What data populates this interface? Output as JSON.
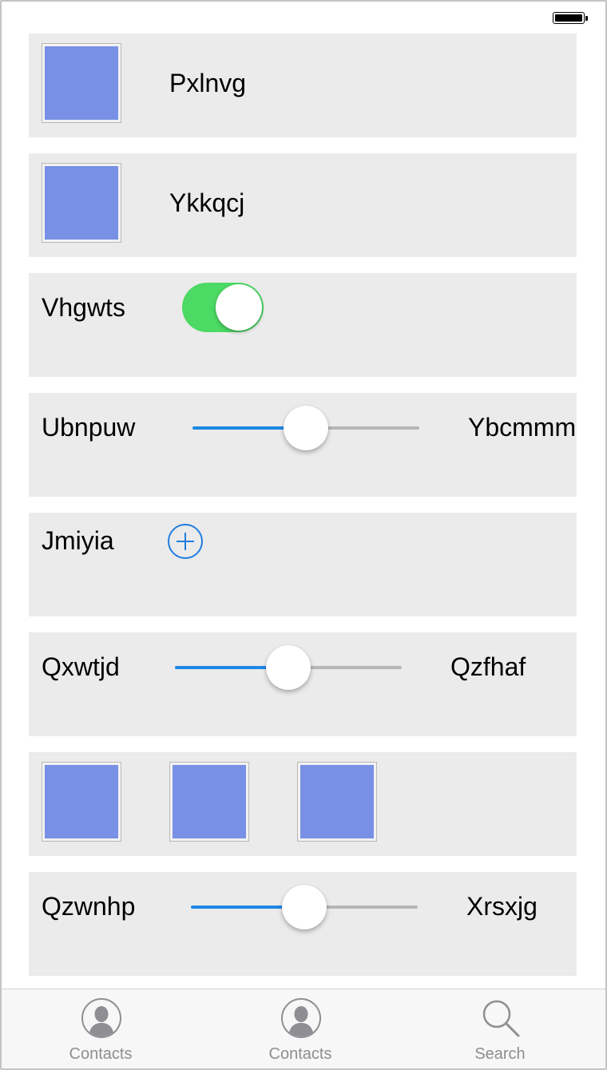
{
  "rows": [
    {
      "type": "image-label",
      "label": "Pxlnvg"
    },
    {
      "type": "image-label",
      "label": "Ykkqcj"
    },
    {
      "type": "toggle",
      "label": "Vhgwts",
      "on": true
    },
    {
      "type": "slider",
      "label": "Ubnpuw",
      "value_label": "Ybcmmm",
      "value": 0.5
    },
    {
      "type": "add",
      "label": "Jmiyia"
    },
    {
      "type": "slider",
      "label": "Qxwtjd",
      "value_label": "Qzfhaf",
      "value": 0.5
    },
    {
      "type": "images",
      "count": 3
    },
    {
      "type": "slider",
      "label": "Qzwnhp",
      "value_label": "Xrsxjg",
      "value": 0.5
    }
  ],
  "tabbar": {
    "tabs": [
      {
        "label": "Contacts",
        "icon": "contacts-icon"
      },
      {
        "label": "Contacts",
        "icon": "contacts-icon"
      },
      {
        "label": "Search",
        "icon": "search-icon"
      }
    ]
  },
  "colors": {
    "row_bg": "#ebebeb",
    "image_fill": "#7890e5",
    "toggle_on": "#4cd964",
    "slider_fill": "#1e88e5",
    "slider_track": "#b6b6b6",
    "accent": "#1f7de0",
    "tab_text": "#8e8e93"
  }
}
